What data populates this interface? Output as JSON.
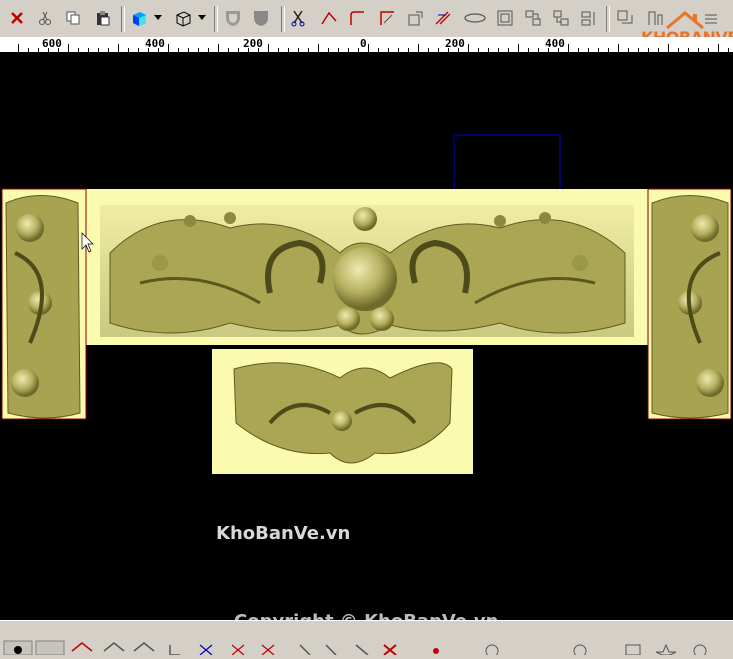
{
  "toolbar": {
    "icons": [
      "close-x-icon",
      "cut-icon",
      "copy-icon",
      "paste-icon",
      "cube-color-icon",
      "dropdown-arrow-icon",
      "cube-wire-icon",
      "dropdown-arrow-icon",
      "shield-outline-icon",
      "shield-solid-icon",
      "scissors-curve-icon",
      "line-join-icon",
      "corner-icon",
      "corner2-icon",
      "offset-icon",
      "trim-icon",
      "ellipse-icon",
      "frame-icon",
      "align1-icon",
      "align2-icon",
      "align3-icon",
      "layout1-icon",
      "layout2-icon",
      "layout3-icon"
    ]
  },
  "ruler": {
    "labels": [
      {
        "text": "600",
        "value": 600
      },
      {
        "text": "400",
        "value": 400
      },
      {
        "text": "200",
        "value": 200
      },
      {
        "text": "0",
        "value": 0
      },
      {
        "text": "200",
        "value": 200
      },
      {
        "text": "400",
        "value": 400
      }
    ]
  },
  "logo": {
    "text": "KHOBANVE"
  },
  "watermarks": {
    "center": "KhoBanVe.vn",
    "copyright": "Copyright © KhoBanVe.vn"
  },
  "colors": {
    "relief_bg": "#fbfbb0",
    "relief_carving": "#9c9a45",
    "selection_outline": "#8b0000",
    "blue_box": "#0000c8"
  }
}
